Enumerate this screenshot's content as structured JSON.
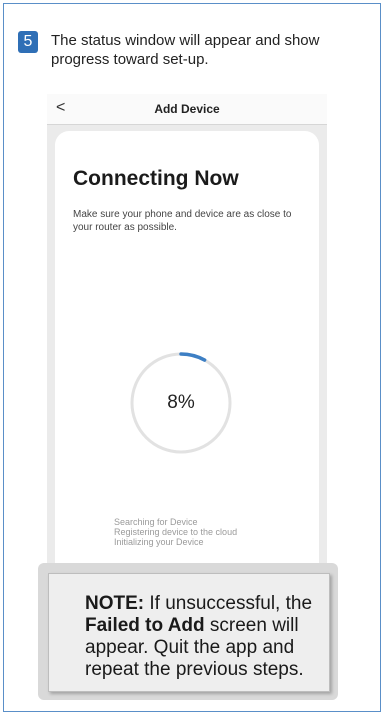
{
  "step": {
    "number": "5",
    "text": "The status window will appear and show progress toward set-up."
  },
  "phone": {
    "nav_back": "<",
    "nav_title": "Add Device",
    "heading": "Connecting Now",
    "description": "Make sure your phone and device are as close to your router as possible.",
    "progress_label": "8%",
    "progress_fraction": 0.08,
    "status_lines": [
      "Searching for Device",
      "Registering device to the cloud",
      "Initializing your Device"
    ],
    "accent_color": "#3d7fc4"
  },
  "note": {
    "prefix": "NOTE:",
    "part1": " If unsuccessful, the ",
    "emphasis": "Failed to Add",
    "part2": " screen will appear. Quit the app and repeat the previous steps."
  }
}
